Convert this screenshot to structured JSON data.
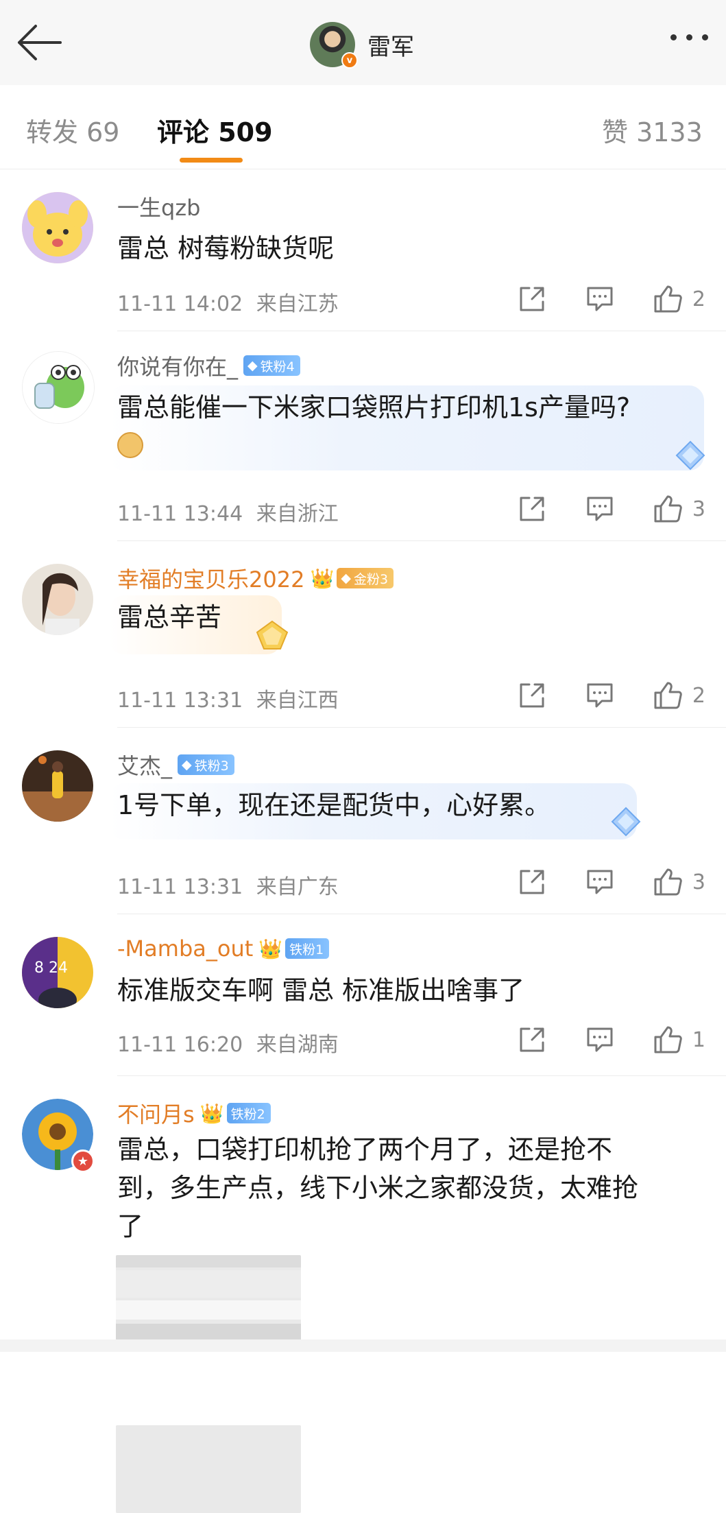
{
  "header": {
    "title": "雷军",
    "verified_mark": "v"
  },
  "tabs": [
    {
      "label": "转发 69"
    },
    {
      "label": "评论 509"
    },
    {
      "label": "赞 3133"
    }
  ],
  "colors": {
    "accent": "#f28b16",
    "gold_name": "#e27d26",
    "iron_badge": "#5fa4f2"
  },
  "comments": [
    {
      "name": "一生qzb",
      "text": "雷总 树莓粉缺货呢",
      "time": "11-11 14:02",
      "location": "来自江苏",
      "likes": "2"
    },
    {
      "name": "你说有你在_",
      "badge": "铁粉4",
      "text": "雷总能催一下米家口袋照片打印机1s产量吗?",
      "emoji": "doge",
      "time": "11-11 13:44",
      "location": "来自浙江",
      "likes": "3"
    },
    {
      "name": "幸福的宝贝乐2022",
      "crown_level": "6",
      "badge": "金粉3",
      "text": "雷总辛苦",
      "time": "11-11 13:31",
      "location": "来自江西",
      "likes": "2"
    },
    {
      "name": "艾杰_",
      "badge": "铁粉3",
      "text": "1号下单，现在还是配货中，心好累。",
      "time": "11-11 13:31",
      "location": "来自广东",
      "likes": "3"
    },
    {
      "name": "-Mamba_out",
      "crown_level": "1",
      "badge": "铁粉1",
      "avatar_numbers": "8 24",
      "text": "标准版交车啊 雷总 标准版出啥事了",
      "time": "11-11 16:20",
      "location": "来自湖南",
      "likes": "1"
    },
    {
      "name": "不问月s",
      "crown_level": "6",
      "badge": "铁粉2",
      "text_lines": [
        "雷总，口袋打印机抢了两个月了，还是抢不",
        "到，多生产点，线下小米之家都没货，太难抢",
        "了"
      ]
    }
  ]
}
